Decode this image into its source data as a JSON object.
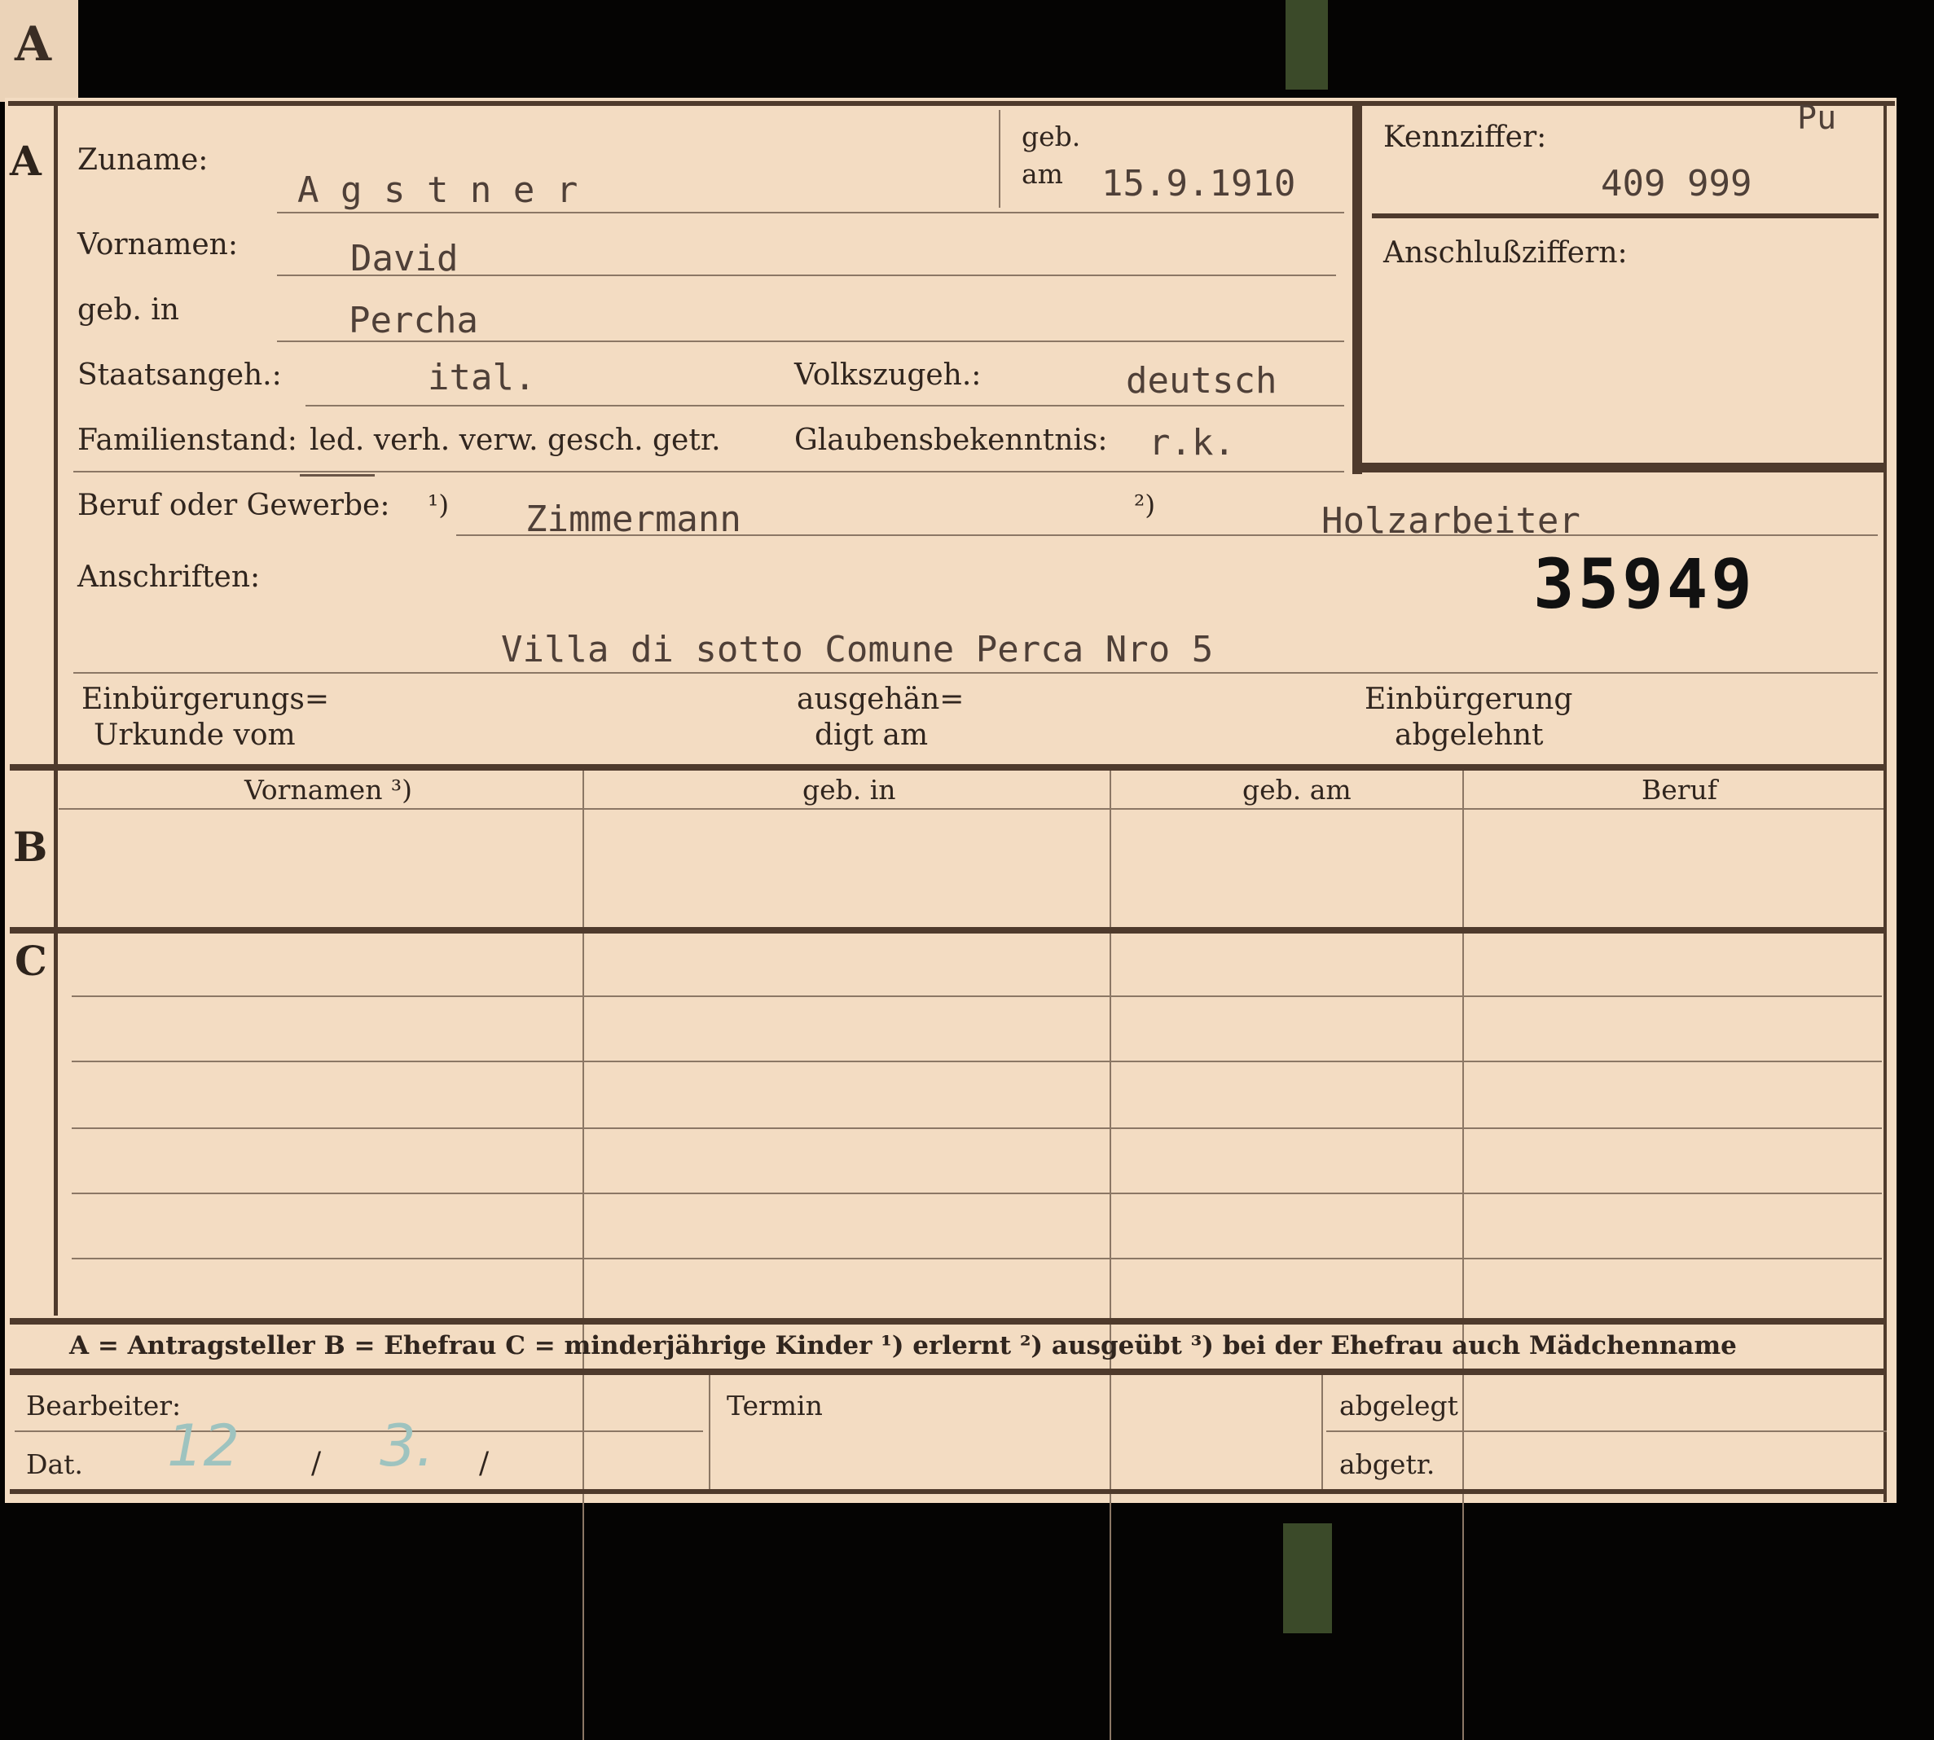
{
  "section_a": {
    "letter": "A",
    "zuname_label": "Zuname:",
    "zuname_value": "A g s t n e r",
    "geb_label": "geb.",
    "am_label": "am",
    "geb_am_value": "15.9.1910",
    "vornamen_label": "Vornamen:",
    "vornamen_value": "David",
    "geb_in_label": "geb. in",
    "geb_in_value": "Percha",
    "staatsangeh_label": "Staatsangeh.:",
    "staatsangeh_value": "ital.",
    "volkszugeh_label": "Volkszugeh.:",
    "volkszugeh_value": "deutsch",
    "familienstand_label": "Familienstand:",
    "familienstand_options": "led. verh. verw. gesch. getr.",
    "glaubens_label": "Glaubensbekenntnis:",
    "glaubens_value": "r.k.",
    "beruf_label": "Beruf oder Gewerbe:",
    "beruf_mark1": "¹)",
    "beruf_value1": "Zimmermann",
    "beruf_mark2": "²)",
    "beruf_value2": "Holzarbeiter",
    "anschriften_label": "Anschriften:",
    "anschriften_value": "Villa di sotto Comune Perca Nro 5",
    "stamp_number": "35949",
    "einb_urkunde_line1": "Einbürgerungs=",
    "einb_urkunde_line2": "Urkunde vom",
    "ausgehaendigt_line1": "ausgehän=",
    "ausgehaendigt_line2": "digt am",
    "einb_abgelehnt_line1": "Einbürgerung",
    "einb_abgelehnt_line2": "abgelehnt"
  },
  "kennziffer": {
    "corner_note": "Pu",
    "label": "Kennziffer:",
    "value": "409 999",
    "anschluss_label": "Anschlußziffern:"
  },
  "section_b": {
    "letter": "B",
    "headers": [
      "Vornamen ³)",
      "geb. in",
      "geb. am",
      "Beruf"
    ]
  },
  "section_c": {
    "letter": "C"
  },
  "legend": {
    "text": "A = Antragsteller   B = Ehefrau   C = minderjährige Kinder   ¹) erlernt   ²) ausgeübt   ³) bei der Ehefrau auch Mädchenname"
  },
  "footer": {
    "bearbeiter_label": "Bearbeiter:",
    "dat_label": "Dat.",
    "dat_day": "12",
    "dat_sep1": "/",
    "dat_month": "3.",
    "dat_sep2": "/",
    "termin_label": "Termin",
    "abgelegt_label": "abgelegt",
    "abgetr_label": "abgetr."
  },
  "colors": {
    "card": "#f3dcc2",
    "background": "#050403",
    "rule": "#4e3a2c",
    "handwriting": "#9ec3bf"
  }
}
